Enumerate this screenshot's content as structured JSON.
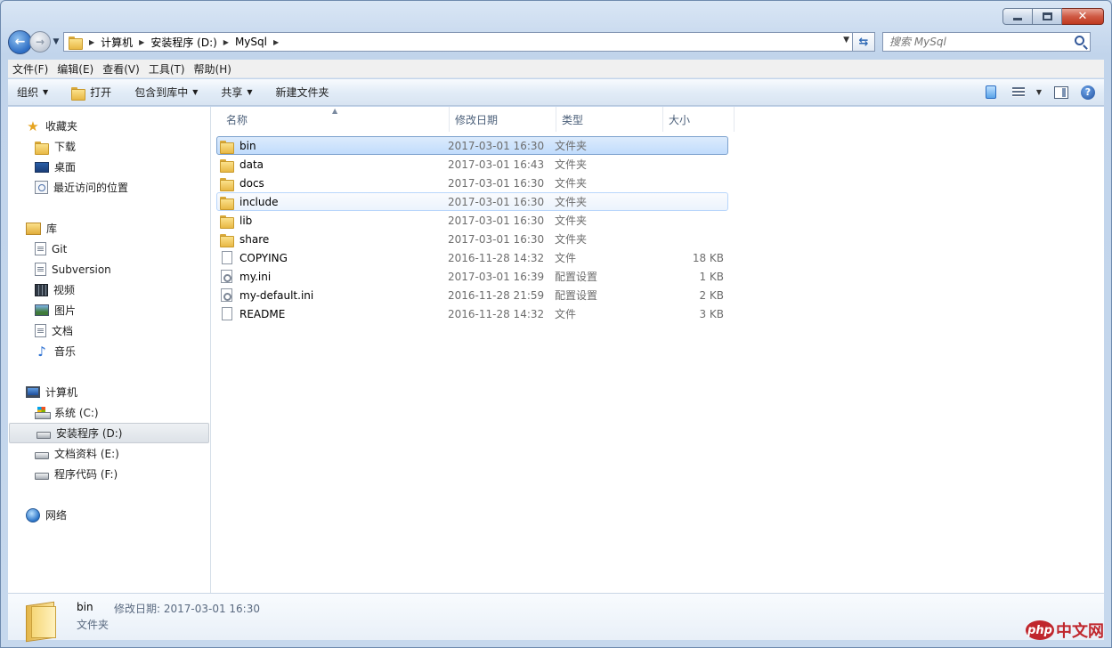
{
  "address": {
    "crumbs": [
      "计算机",
      "安装程序 (D:)",
      "MySql"
    ]
  },
  "search": {
    "placeholder": "搜索 MySql"
  },
  "menu": [
    "文件(F)",
    "编辑(E)",
    "查看(V)",
    "工具(T)",
    "帮助(H)"
  ],
  "commands": {
    "organize": "组织",
    "open": "打开",
    "include_library": "包含到库中",
    "share": "共享",
    "new_folder": "新建文件夹"
  },
  "nav": {
    "favorites": {
      "label": "收藏夹",
      "items": [
        "下载",
        "桌面",
        "最近访问的位置"
      ]
    },
    "libraries": {
      "label": "库",
      "items": [
        "Git",
        "Subversion",
        "视频",
        "图片",
        "文档",
        "音乐"
      ]
    },
    "computer": {
      "label": "计算机",
      "items": [
        "系统 (C:)",
        "安装程序 (D:)",
        "文档资料 (E:)",
        "程序代码 (F:)"
      ]
    },
    "network": {
      "label": "网络"
    }
  },
  "columns": {
    "name": "名称",
    "modified": "修改日期",
    "type": "类型",
    "size": "大小"
  },
  "files": [
    {
      "name": "bin",
      "modified": "2017-03-01 16:30",
      "type": "文件夹",
      "size": "",
      "icon": "folder-icon"
    },
    {
      "name": "data",
      "modified": "2017-03-01 16:43",
      "type": "文件夹",
      "size": "",
      "icon": "folder-icon"
    },
    {
      "name": "docs",
      "modified": "2017-03-01 16:30",
      "type": "文件夹",
      "size": "",
      "icon": "folder-icon"
    },
    {
      "name": "include",
      "modified": "2017-03-01 16:30",
      "type": "文件夹",
      "size": "",
      "icon": "folder-icon"
    },
    {
      "name": "lib",
      "modified": "2017-03-01 16:30",
      "type": "文件夹",
      "size": "",
      "icon": "folder-icon"
    },
    {
      "name": "share",
      "modified": "2017-03-01 16:30",
      "type": "文件夹",
      "size": "",
      "icon": "folder-icon"
    },
    {
      "name": "COPYING",
      "modified": "2016-11-28 14:32",
      "type": "文件",
      "size": "18 KB",
      "icon": "file-icon"
    },
    {
      "name": "my.ini",
      "modified": "2017-03-01 16:39",
      "type": "配置设置",
      "size": "1 KB",
      "icon": "ini-file-icon"
    },
    {
      "name": "my-default.ini",
      "modified": "2016-11-28 21:59",
      "type": "配置设置",
      "size": "2 KB",
      "icon": "ini-file-icon"
    },
    {
      "name": "README",
      "modified": "2016-11-28 14:32",
      "type": "文件",
      "size": "3 KB",
      "icon": "file-icon"
    }
  ],
  "details": {
    "name": "bin",
    "modified_label": "修改日期: 2017-03-01 16:30",
    "type": "文件夹"
  },
  "watermark": {
    "logo": "php",
    "text": "中文网"
  }
}
